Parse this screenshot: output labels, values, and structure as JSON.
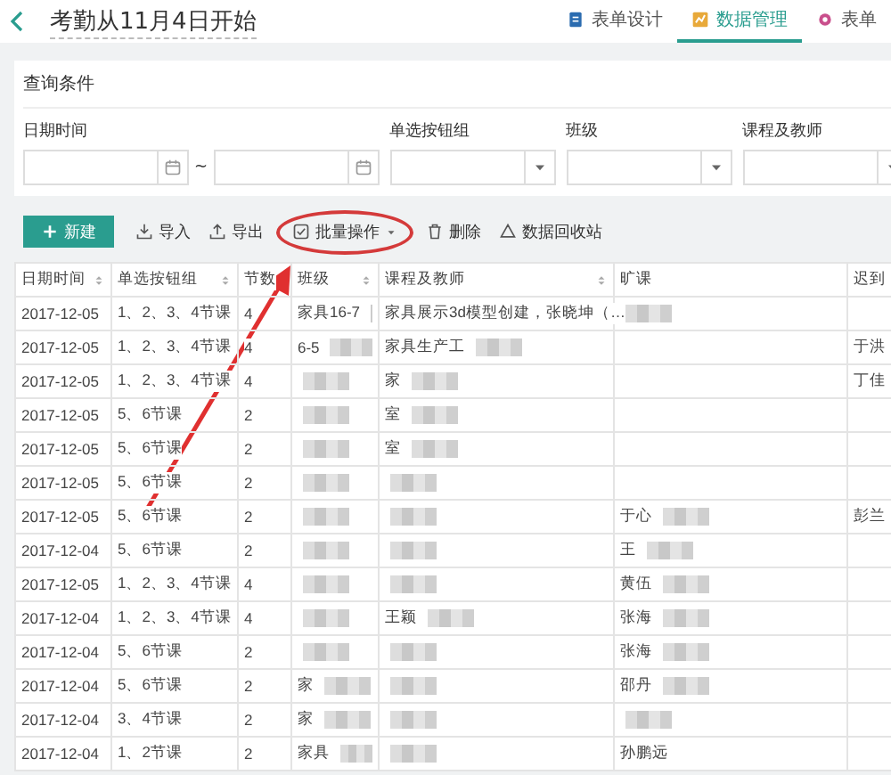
{
  "header": {
    "title": "考勤从11月4日开始",
    "tabs": [
      {
        "label": "表单设计",
        "selected": false
      },
      {
        "label": "数据管理",
        "selected": true
      },
      {
        "label": "表单",
        "selected": false
      }
    ]
  },
  "query": {
    "title": "查询条件",
    "filters": [
      {
        "label": "日期时间",
        "kind": "daterange",
        "separator": "~"
      },
      {
        "label": "单选按钮组",
        "kind": "select"
      },
      {
        "label": "班级",
        "kind": "select"
      },
      {
        "label": "课程及教师",
        "kind": "select"
      }
    ]
  },
  "toolbar": [
    {
      "label": "新建",
      "kind": "primary"
    },
    {
      "label": "导入",
      "kind": "plain"
    },
    {
      "label": "导出",
      "kind": "plain"
    },
    {
      "label": "批量操作",
      "kind": "dropdown"
    },
    {
      "label": "删除",
      "kind": "plain"
    },
    {
      "label": "数据回收站",
      "kind": "plain"
    }
  ],
  "table": {
    "columns": [
      {
        "label": "日期时间",
        "kind": "sortable"
      },
      {
        "label": "单选按钮组",
        "kind": "sortable"
      },
      {
        "label": "节数",
        "kind": "plain"
      },
      {
        "label": "班级",
        "kind": "sortable"
      },
      {
        "label": "课程及教师",
        "kind": "sortable"
      },
      {
        "label": "旷课",
        "kind": "plain"
      },
      {
        "label": "迟到",
        "kind": "plain"
      }
    ],
    "rows": [
      [
        "2017-12-05",
        "1、2、3、4节课",
        "4",
        {
          "text": "家具16-7",
          "blurred": true
        },
        "家具展示3d模型创建，张晓坤（…",
        {
          "text": "",
          "blurred": true
        },
        ""
      ],
      [
        "2017-12-05",
        "1、2、3、4节课",
        "4",
        {
          "text": "6-5",
          "blurred": true
        },
        {
          "text": "家具生产工",
          "blurred": true
        },
        "",
        "于洪"
      ],
      [
        "2017-12-05",
        "1、2、3、4节课",
        "4",
        {
          "text": "",
          "blurred": true
        },
        {
          "text": "家",
          "blurred": true
        },
        "",
        "丁佳"
      ],
      [
        "2017-12-05",
        "5、6节课",
        "2",
        {
          "text": "",
          "blurred": true
        },
        {
          "text": "室",
          "blurred": true
        },
        "",
        ""
      ],
      [
        "2017-12-05",
        "5、6节课",
        "2",
        {
          "text": "",
          "blurred": true
        },
        {
          "text": "室",
          "blurred": true
        },
        "",
        ""
      ],
      [
        "2017-12-05",
        "5、6节课",
        "2",
        {
          "text": "",
          "blurred": true
        },
        {
          "text": "",
          "blurred": true
        },
        "",
        ""
      ],
      [
        "2017-12-05",
        "5、6节课",
        "2",
        {
          "text": "",
          "blurred": true
        },
        {
          "text": "",
          "blurred": true
        },
        {
          "text": "于心",
          "blurred": true
        },
        "彭兰"
      ],
      [
        "2017-12-04",
        "5、6节课",
        "2",
        {
          "text": "",
          "blurred": true
        },
        {
          "text": "",
          "blurred": true
        },
        {
          "text": "王",
          "blurred": true
        },
        ""
      ],
      [
        "2017-12-05",
        "1、2、3、4节课",
        "4",
        {
          "text": "",
          "blurred": true
        },
        {
          "text": "",
          "blurred": true
        },
        {
          "text": "黄伍",
          "blurred": true
        },
        ""
      ],
      [
        "2017-12-04",
        "1、2、3、4节课",
        "4",
        {
          "text": "",
          "blurred": true
        },
        {
          "text": "王颖",
          "blurred": true
        },
        {
          "text": "张海",
          "blurred": true
        },
        ""
      ],
      [
        "2017-12-04",
        "5、6节课",
        "2",
        {
          "text": "",
          "blurred": true
        },
        {
          "text": "",
          "blurred": true
        },
        {
          "text": "张海",
          "blurred": true
        },
        ""
      ],
      [
        "2017-12-04",
        "5、6节课",
        "2",
        {
          "text": "家",
          "blurred": true
        },
        {
          "text": "",
          "blurred": true
        },
        {
          "text": "邵丹",
          "blurred": true
        },
        ""
      ],
      [
        "2017-12-04",
        "3、4节课",
        "2",
        {
          "text": "家",
          "blurred": true
        },
        {
          "text": "",
          "blurred": true
        },
        {
          "text": "",
          "blurred": true
        },
        ""
      ],
      [
        "2017-12-04",
        "1、2节课",
        "2",
        {
          "text": "家具",
          "blurred": true
        },
        {
          "text": "",
          "blurred": true
        },
        "孙鹏远",
        ""
      ]
    ]
  },
  "annotation": {
    "kind": "arrow-circle"
  }
}
